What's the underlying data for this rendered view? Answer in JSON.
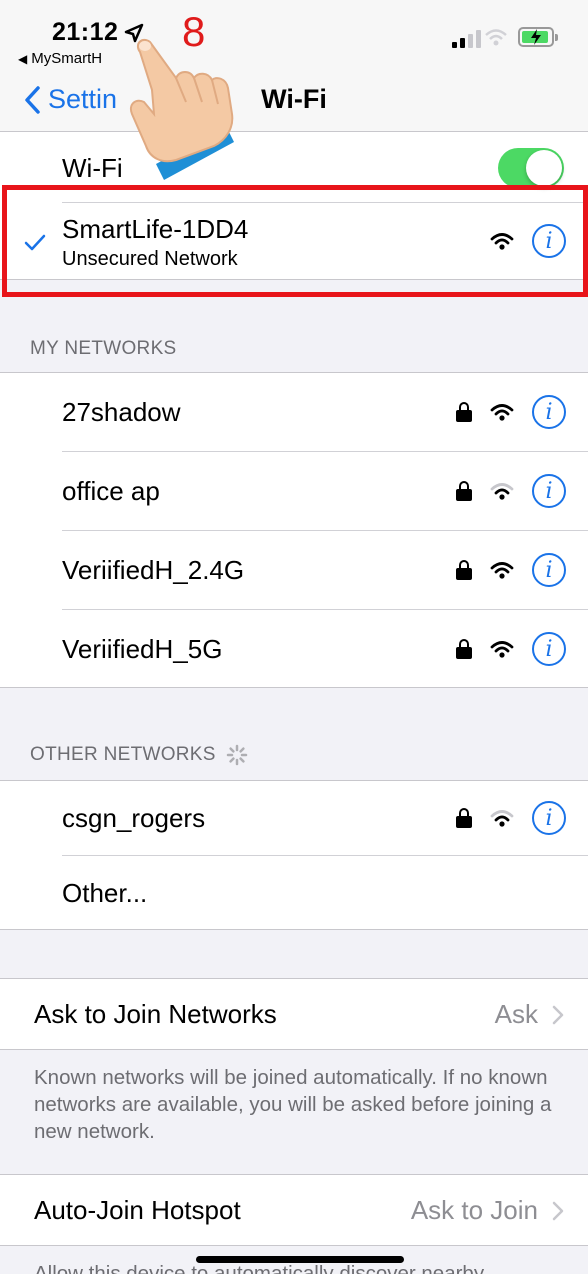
{
  "status_bar": {
    "time": "21:12",
    "back_app": "MySmartH",
    "step_number": "8"
  },
  "nav": {
    "back_label": "Settin",
    "title": "Wi-Fi"
  },
  "wifi_toggle": {
    "label": "Wi-Fi",
    "on": true
  },
  "connected": {
    "name": "SmartLife-1DD4",
    "subtitle": "Unsecured Network"
  },
  "my_networks": {
    "header": "MY NETWORKS",
    "items": [
      {
        "name": "27shadow",
        "locked": true,
        "signal": 3
      },
      {
        "name": "office ap",
        "locked": true,
        "signal": 2
      },
      {
        "name": "VeriifiedH_2.4G",
        "locked": true,
        "signal": 3
      },
      {
        "name": "VeriifiedH_5G",
        "locked": true,
        "signal": 3
      }
    ]
  },
  "other_networks": {
    "header": "OTHER NETWORKS",
    "items": [
      {
        "name": "csgn_rogers",
        "locked": true,
        "signal": 2
      }
    ],
    "other_label": "Other..."
  },
  "ask_to_join": {
    "label": "Ask to Join Networks",
    "value": "Ask",
    "footnote": "Known networks will be joined automatically. If no known networks are available, you will be asked before joining a new network."
  },
  "auto_join": {
    "label": "Auto-Join Hotspot",
    "value": "Ask to Join",
    "footnote": "Allow this device to automatically discover nearby"
  },
  "colors": {
    "accent": "#1a73e8",
    "toggle_on": "#4cd964",
    "highlight": "#e8141a"
  }
}
